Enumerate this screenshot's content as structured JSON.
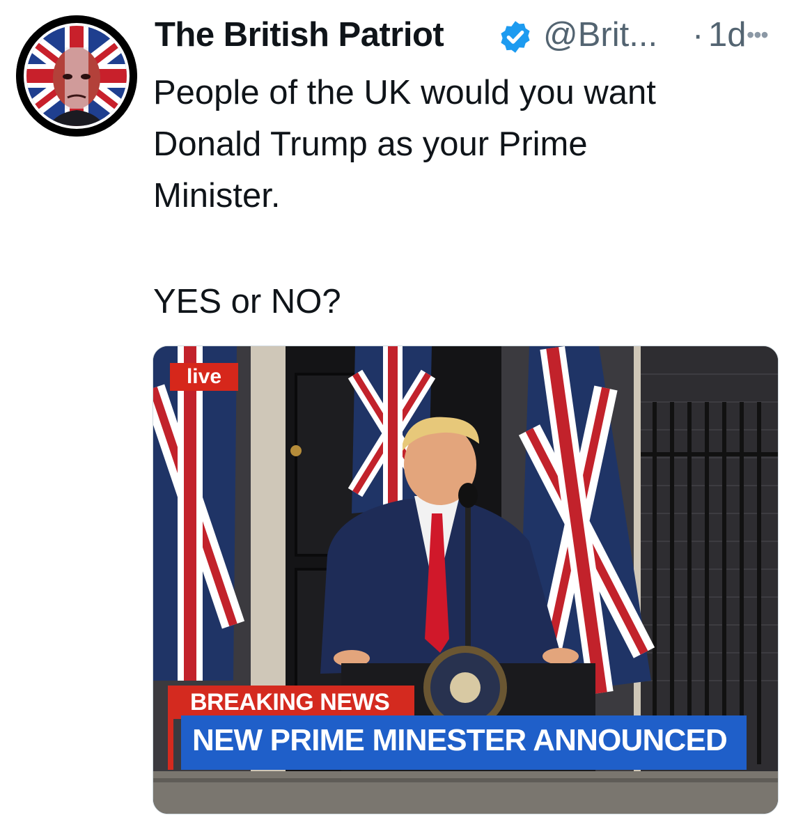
{
  "post": {
    "author_name": "The British Patriot",
    "handle": "@Brit...",
    "separator": "·",
    "time": "1d",
    "more_icon": "more-horizontal-icon",
    "verified_icon": "verified-badge-icon",
    "text_lines": [
      "People of the UK would you want",
      "Donald Trump as your Prime",
      "Minister."
    ],
    "question": "YES or NO?"
  },
  "media": {
    "live_badge": "live",
    "breaking_label": "BREAKING NEWS",
    "headline": "NEW PRIME MINESTER ANNOUNCED"
  },
  "colors": {
    "verified": "#1d9bf0",
    "text": "#0f1419",
    "muted": "#536471",
    "breaking_red": "#d42a1f",
    "headline_blue": "#1f5fc9"
  }
}
